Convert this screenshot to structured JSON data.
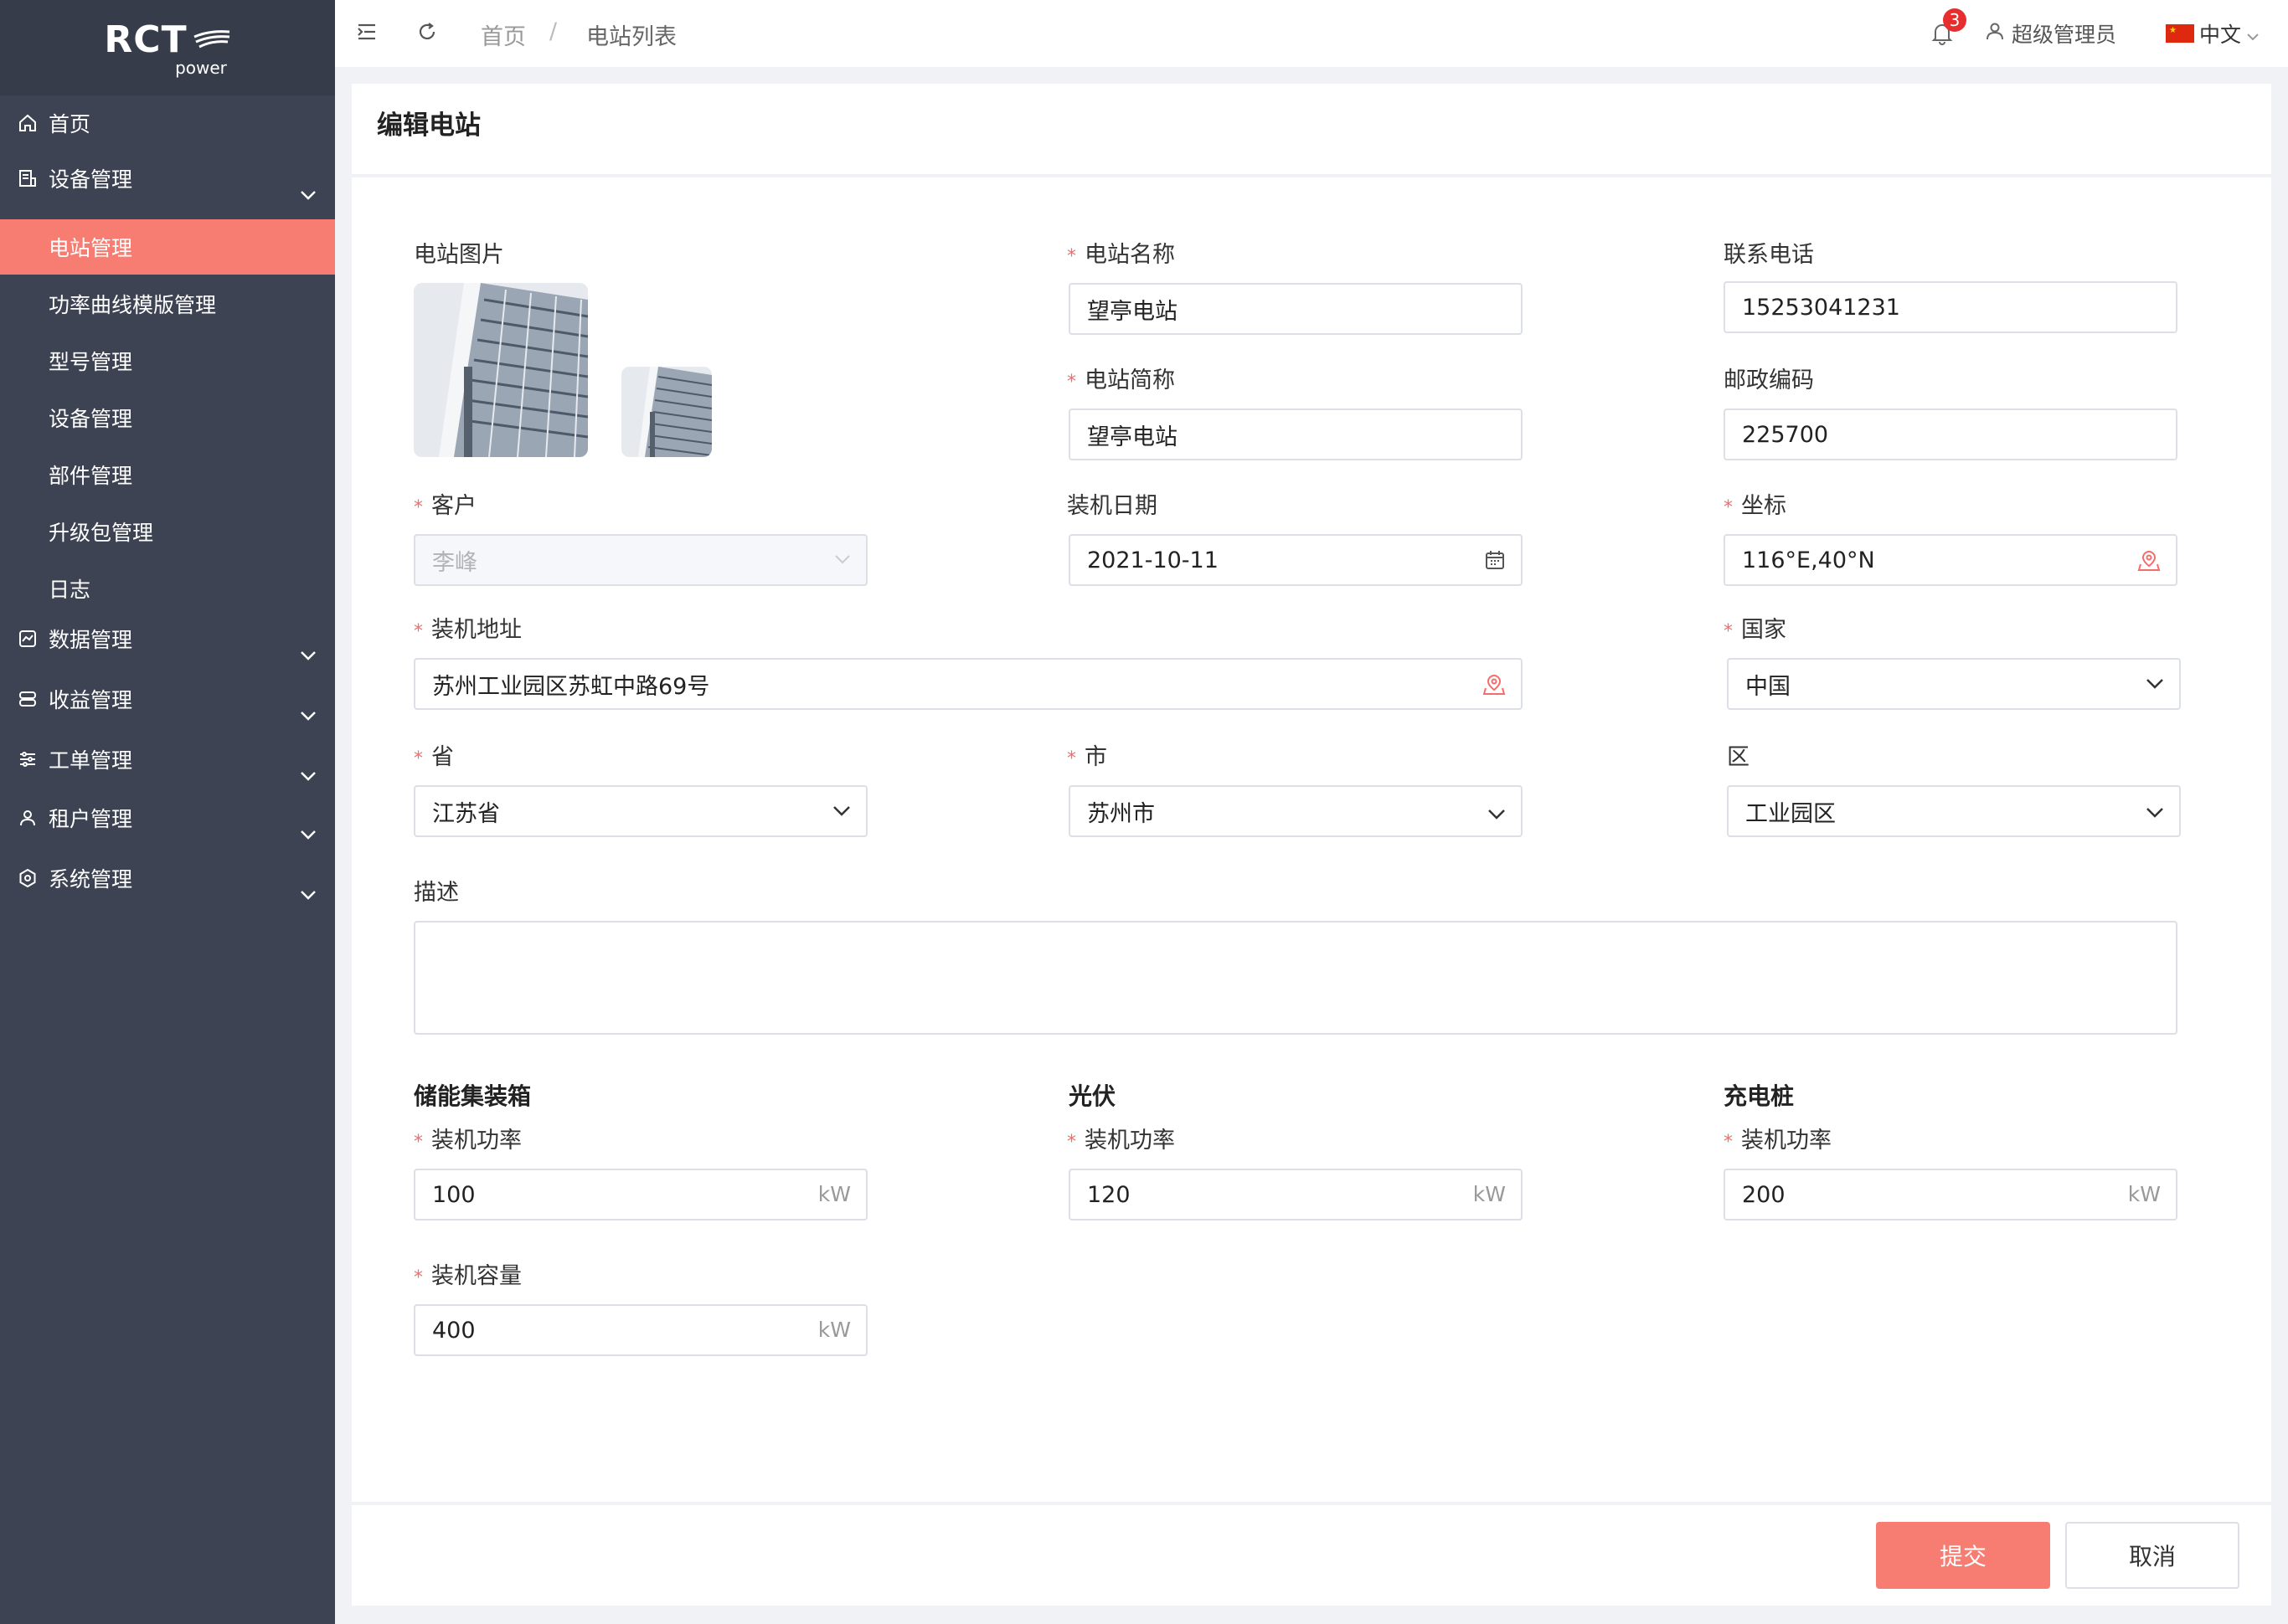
{
  "logo": {
    "main": "RCT",
    "sub": "power"
  },
  "sidebar": {
    "items": [
      {
        "label": "首页",
        "icon": "home-icon"
      },
      {
        "label": "设备管理",
        "icon": "device-icon"
      },
      {
        "label": "数据管理",
        "icon": "data-icon"
      },
      {
        "label": "收益管理",
        "icon": "revenue-icon"
      },
      {
        "label": "工单管理",
        "icon": "workorder-icon"
      },
      {
        "label": "租户管理",
        "icon": "tenant-icon"
      },
      {
        "label": "系统管理",
        "icon": "settings-icon"
      }
    ],
    "subitems": [
      "电站管理",
      "功率曲线模版管理",
      "型号管理",
      "设备管理",
      "部件管理",
      "升级包管理",
      "日志"
    ]
  },
  "topbar": {
    "breadcrumb": [
      "首页",
      "/",
      "电站列表"
    ],
    "notification_count": "3",
    "user": "超级管理员",
    "language": "中文"
  },
  "page": {
    "title": "编辑电站"
  },
  "form": {
    "photo_label": "电站图片",
    "name_label": "电站名称",
    "name_value": "望亭电站",
    "phone_label": "联系电话",
    "phone_value": "15253041231",
    "short_label": "电站简称",
    "short_value": "望亭电站",
    "postal_label": "邮政编码",
    "postal_value": "225700",
    "customer_label": "客户",
    "customer_value": "李峰",
    "date_label": "装机日期",
    "date_value": "2021-10-11",
    "coord_label": "坐标",
    "coord_value": "116°E,40°N",
    "address_label": "装机地址",
    "address_value": "苏州工业园区苏虹中路69号",
    "country_label": "国家",
    "country_value": "中国",
    "province_label": "省",
    "province_value": "江苏省",
    "city_label": "市",
    "city_value": "苏州市",
    "district_label": "区",
    "district_value": "工业园区",
    "desc_label": "描述",
    "storage_title": "储能集装箱",
    "pv_title": "光伏",
    "charger_title": "充电桩",
    "power_label": "装机功率",
    "capacity_label": "装机容量",
    "storage_power": "100",
    "pv_power": "120",
    "charger_power": "200",
    "storage_capacity": "400",
    "unit": "kW"
  },
  "actions": {
    "submit": "提交",
    "cancel": "取消"
  },
  "colors": {
    "sidebar": "#3d4352",
    "accent": "#f77c72",
    "required": "#f56c6c"
  }
}
